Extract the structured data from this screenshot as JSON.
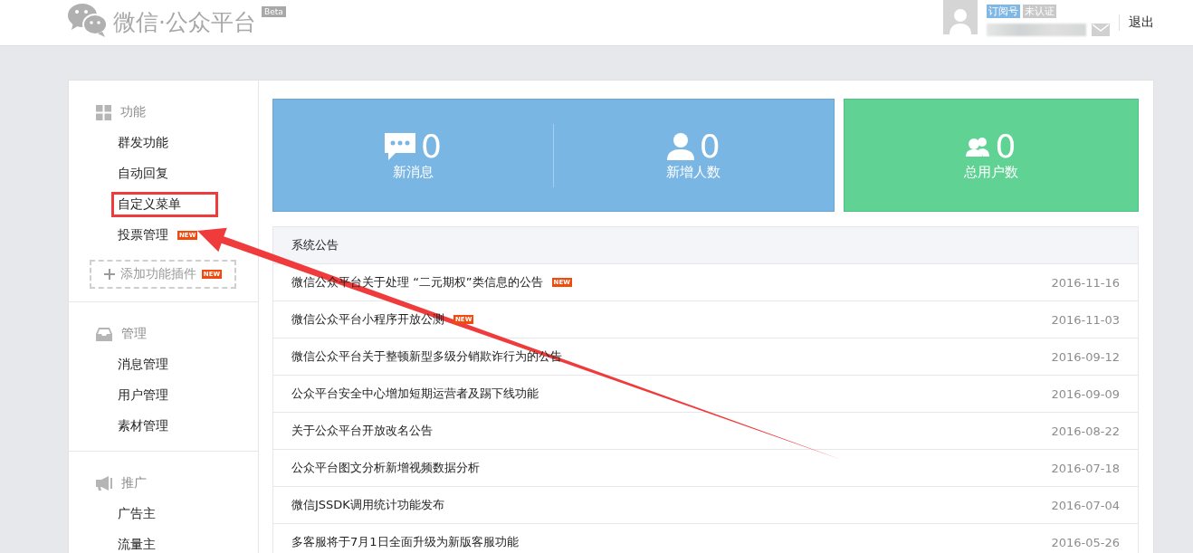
{
  "header": {
    "logo_text": "微信·公众平台",
    "beta": "Beta",
    "account_badges": [
      {
        "label": "订阅号",
        "kind": "type"
      },
      {
        "label": "未认证",
        "kind": "status"
      }
    ],
    "logout": "退出"
  },
  "sidebar": {
    "sections": [
      {
        "title": "功能",
        "kind": "grid",
        "items": [
          {
            "label": "群发功能",
            "highlighted": false
          },
          {
            "label": "自动回复",
            "highlighted": false
          },
          {
            "label": "自定义菜单",
            "highlighted": true
          },
          {
            "label": "投票管理",
            "highlighted": false,
            "badge": "NEW"
          }
        ],
        "add_button": {
          "label": "添加功能插件",
          "badge": "NEW"
        }
      },
      {
        "title": "管理",
        "kind": "inbox",
        "items": [
          {
            "label": "消息管理",
            "highlighted": false
          },
          {
            "label": "用户管理",
            "highlighted": false
          },
          {
            "label": "素材管理",
            "highlighted": false
          }
        ]
      },
      {
        "title": "推广",
        "kind": "megaphone",
        "items": [
          {
            "label": "广告主",
            "highlighted": false
          },
          {
            "label": "流量主",
            "highlighted": false
          }
        ]
      }
    ]
  },
  "stats": [
    {
      "kind": "blue",
      "items": [
        {
          "kind": "messages",
          "value": "0",
          "label": "新消息"
        },
        {
          "kind": "new_followers",
          "value": "0",
          "label": "新增人数"
        }
      ]
    },
    {
      "kind": "green",
      "items": [
        {
          "kind": "total_users",
          "value": "0",
          "label": "总用户数"
        }
      ]
    }
  ],
  "notices": {
    "title": "系统公告",
    "rows": [
      {
        "title": "微信公众平台关于处理 “二元期权”类信息的公告",
        "badge": "NEW",
        "date": "2016-11-16"
      },
      {
        "title": "微信公众平台小程序开放公测",
        "badge": "NEW",
        "date": "2016-11-03"
      },
      {
        "title": "微信公众平台关于整顿新型多级分销欺诈行为的公告",
        "date": "2016-09-12"
      },
      {
        "title": "公众平台安全中心增加短期运营者及踢下线功能",
        "date": "2016-09-09"
      },
      {
        "title": "关于公众平台开放改名公告",
        "date": "2016-08-22"
      },
      {
        "title": "公众平台图文分析新增视频数据分析",
        "date": "2016-07-18"
      },
      {
        "title": "微信JSSDK调用统计功能发布",
        "date": "2016-07-04"
      },
      {
        "title": "多客服将于7月1日全面升级为新版客服功能",
        "date": "2016-05-26"
      }
    ]
  },
  "annotation": {
    "arrow": true
  }
}
